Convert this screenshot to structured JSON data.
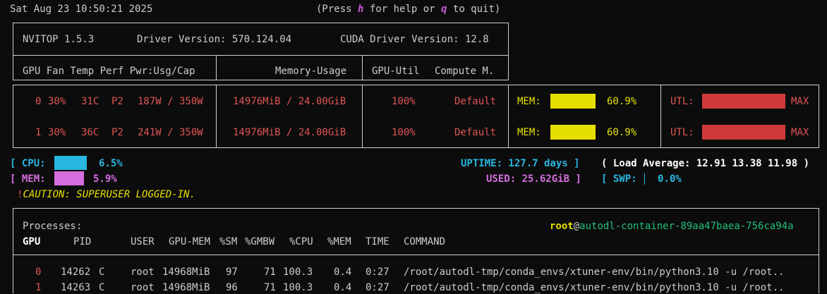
{
  "header": {
    "timestamp": "Sat Aug 23 10:50:21 2025",
    "help_prefix": "(Press ",
    "help_key": "h",
    "help_mid": " for help or ",
    "quit_key": "q",
    "help_suffix": " to quit)"
  },
  "gpu_table": {
    "nvitop_version": "NVITOP 1.5.3",
    "driver_version": "Driver Version: 570.124.04",
    "cuda_version": "CUDA Driver Version: 12.8",
    "col_gpu_fan_temp": "GPU Fan Temp Perf Pwr:Usg/Cap",
    "col_memory": "Memory-Usage",
    "col_util": "GPU-Util",
    "col_compute": "Compute M.",
    "rows": [
      {
        "id": "0",
        "fan": "30%",
        "temp": "31C",
        "perf": "P2",
        "power": "187W / 350W",
        "memory": "14976MiB / 24.00GiB",
        "util": "100%",
        "compute": "Default",
        "mem_label": "MEM:",
        "mem_pct": "60.9%",
        "mem_fraction": 0.609,
        "utl_label": "UTL:",
        "utl_value": "MAX",
        "utl_fraction": 1.0
      },
      {
        "id": "1",
        "fan": "30%",
        "temp": "36C",
        "perf": "P2",
        "power": "241W / 350W",
        "memory": "14976MiB / 24.00GiB",
        "util": "100%",
        "compute": "Default",
        "mem_label": "MEM:",
        "mem_pct": "60.9%",
        "mem_fraction": 0.609,
        "utl_label": "UTL:",
        "utl_value": "MAX",
        "utl_fraction": 1.0
      }
    ]
  },
  "host": {
    "cpu_label": "CPU:",
    "cpu_pct": "6.5%",
    "cpu_fraction": 0.065,
    "mem_label": "MEM:",
    "mem_pct": "5.9%",
    "mem_fraction": 0.059,
    "uptime": "UPTIME: 127.7 days",
    "load_average": "( Load Average: 12.91 13.38 11.98 )",
    "used": "USED: 25.62GiB",
    "swp_label": "SWP:",
    "swp_pct": "0.0%",
    "caution_mark": "!",
    "caution": "CAUTION: SUPERUSER LOGGED-IN."
  },
  "processes": {
    "title": "Processes:",
    "user": "root",
    "at": "@",
    "hostname": "autodl-container-89aa47baea-756ca94a",
    "columns": [
      "GPU",
      "PID",
      "USER",
      "GPU-MEM",
      "%SM",
      "%GMBW",
      "%CPU",
      "%MEM",
      "TIME",
      "COMMAND"
    ],
    "rows": [
      {
        "gpu": "0",
        "pid": "14262",
        "type": "C",
        "user": "root",
        "gpu_mem": "14968MiB",
        "sm": "97",
        "gmbw": "71",
        "cpu": "100.3",
        "mem": "0.4",
        "time": "0:27",
        "command": "/root/autodl-tmp/conda_envs/xtuner-env/bin/python3.10 -u /root.."
      },
      {
        "gpu": "1",
        "pid": "14263",
        "type": "C",
        "user": "root",
        "gpu_mem": "14968MiB",
        "sm": "96",
        "gmbw": "71",
        "cpu": "100.3",
        "mem": "0.4",
        "time": "0:27",
        "command": "/root/autodl-tmp/conda_envs/xtuner-env/bin/python3.10 -u /root.."
      }
    ]
  },
  "colors": {
    "text": "#cccccc",
    "red": "#e05555",
    "yellow_bar": "#e6e000",
    "red_bar": "#d03a3a",
    "cyan_bar": "#29b6e0",
    "magenta_bar": "#d66ee0",
    "green": "#22c07a"
  }
}
